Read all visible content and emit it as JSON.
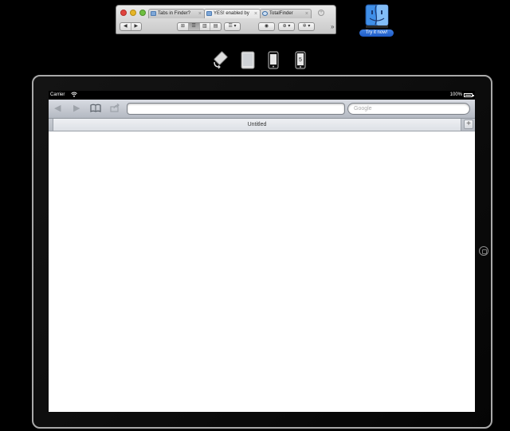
{
  "promo_window": {
    "tabs": [
      {
        "label": "Tabs in Finder?"
      },
      {
        "label": "YES! enabled by"
      },
      {
        "label": "TotalFinder"
      }
    ],
    "tab_close_glyph": "×",
    "new_tab_glyph": "+",
    "nav_back": "◀",
    "nav_forward": "▶",
    "view_modes": [
      "⊞",
      "☰",
      "▥",
      "▤"
    ],
    "arrange_label": "☰ ▾",
    "quicklook_label": "◉",
    "share_label": "⊕ ▾",
    "action_label": "✲ ▾",
    "overflow_label": "»"
  },
  "promo": {
    "button_label": "Try it now!",
    "icon": "finder-face-icon"
  },
  "device_icons": [
    "rotate-icon",
    "ipad-icon",
    "iphone-icon",
    "iphone-5-icon"
  ],
  "device_icon_badge": "5",
  "status_bar": {
    "carrier": "Carrier",
    "battery": "100%"
  },
  "safari": {
    "url_value": "",
    "search_placeholder": "Google",
    "tab_title": "Untitled",
    "new_tab_label": "+",
    "icons": {
      "back": "◀",
      "forward": "▶",
      "bookmarks": "📖",
      "share": "⇪"
    }
  },
  "colors": {
    "background": "#000000",
    "promo_button": "#2566d2",
    "toolbar": "#c4c8cf"
  }
}
